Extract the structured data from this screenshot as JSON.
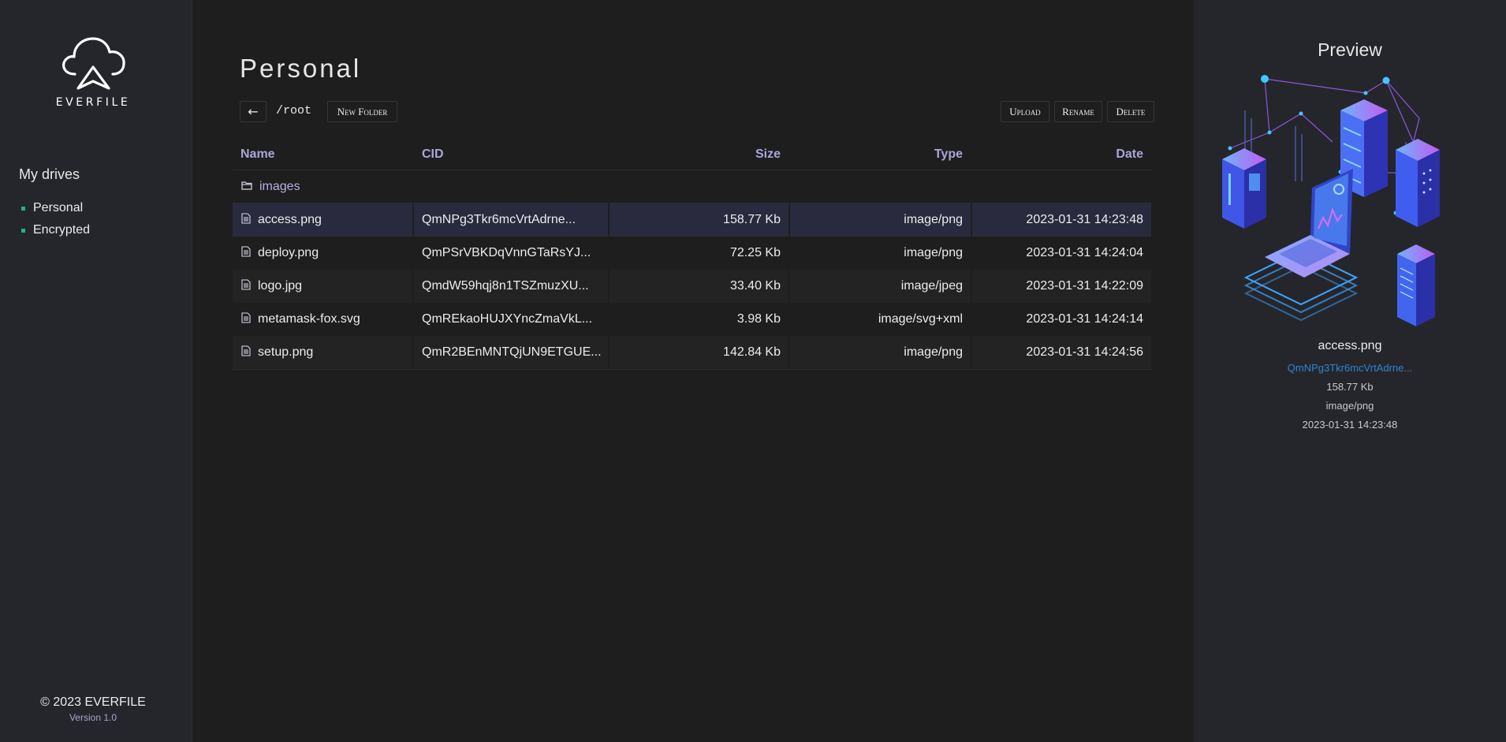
{
  "sidebar": {
    "logo_text": "EVERFILE",
    "drives_title": "My drives",
    "drives": [
      {
        "label": "Personal"
      },
      {
        "label": "Encrypted"
      }
    ],
    "copyright": "© 2023 EVERFILE",
    "version": "Version 1.0"
  },
  "main": {
    "title": "Personal",
    "toolbar": {
      "back_label": "←",
      "path": "/root",
      "new_folder_label": "New Folder",
      "upload_label": "Upload",
      "rename_label": "Rename",
      "delete_label": "Delete"
    },
    "table": {
      "headers": [
        "Name",
        "CID",
        "Size",
        "Type",
        "Date"
      ],
      "folders": [
        {
          "name": "images",
          "icon": "folder-icon"
        }
      ],
      "files": [
        {
          "name": "access.png",
          "cid": "QmNPg3Tkr6mcVrtAdrne...",
          "size": "158.77 Kb",
          "type": "image/png",
          "date": "2023-01-31 14:23:48",
          "selected": true,
          "icon": "file-icon"
        },
        {
          "name": "deploy.png",
          "cid": "QmPSrVBKDqVnnGTaRsYJ...",
          "size": "72.25 Kb",
          "type": "image/png",
          "date": "2023-01-31 14:24:04",
          "selected": false,
          "icon": "file-icon"
        },
        {
          "name": "logo.jpg",
          "cid": "QmdW59hqj8n1TSZmuzXU...",
          "size": "33.40 Kb",
          "type": "image/jpeg",
          "date": "2023-01-31 14:22:09",
          "selected": false,
          "icon": "file-icon"
        },
        {
          "name": "metamask-fox.svg",
          "cid": "QmREkaoHUJXYncZmaVkL...",
          "size": "3.98 Kb",
          "type": "image/svg+xml",
          "date": "2023-01-31 14:24:14",
          "selected": false,
          "icon": "file-icon"
        },
        {
          "name": "setup.png",
          "cid": "QmR2BEnMNTQjUN9ETGUE...",
          "size": "142.84 Kb",
          "type": "image/png",
          "date": "2023-01-31 14:24:56",
          "selected": false,
          "icon": "file-icon"
        }
      ]
    }
  },
  "preview": {
    "title": "Preview",
    "name": "access.png",
    "cid": "QmNPg3Tkr6mcVrtAdrne...",
    "size": "158.77 Kb",
    "type": "image/png",
    "date": "2023-01-31 14:23:48"
  },
  "colors": {
    "accent_green": "#27b37a",
    "header_purple": "#a9a6d8",
    "link_blue": "#2e84d6",
    "selected_row": "#2a2a3e"
  }
}
